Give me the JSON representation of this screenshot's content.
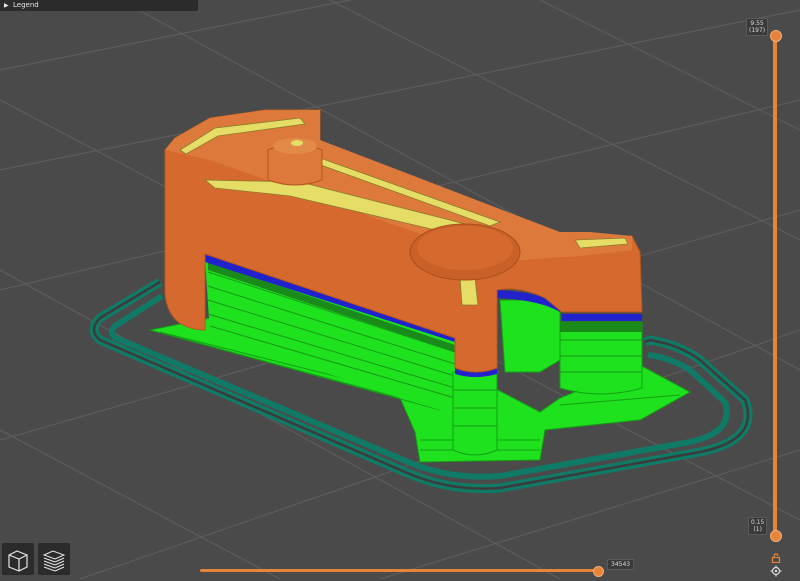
{
  "legend": {
    "label": "Legend"
  },
  "layer_slider": {
    "top_height": "9.55",
    "top_layer": "(197)",
    "bottom_height": "0.15",
    "bottom_layer": "(1)"
  },
  "move_slider": {
    "value": "34543"
  },
  "colors": {
    "background": "#4a4a4a",
    "grid": "#5e5e5e",
    "perimeter": "#d66a2e",
    "infill": "#e6dd66",
    "support": "#1fe21f",
    "support_interface": "#1a9a1a",
    "skirt": "#0f7a66",
    "interface_band": "#2222cc",
    "accent": "#e8833a"
  },
  "icons": [
    "lock-icon",
    "cog-icon",
    "view-3d-icon",
    "view-layers-icon"
  ]
}
